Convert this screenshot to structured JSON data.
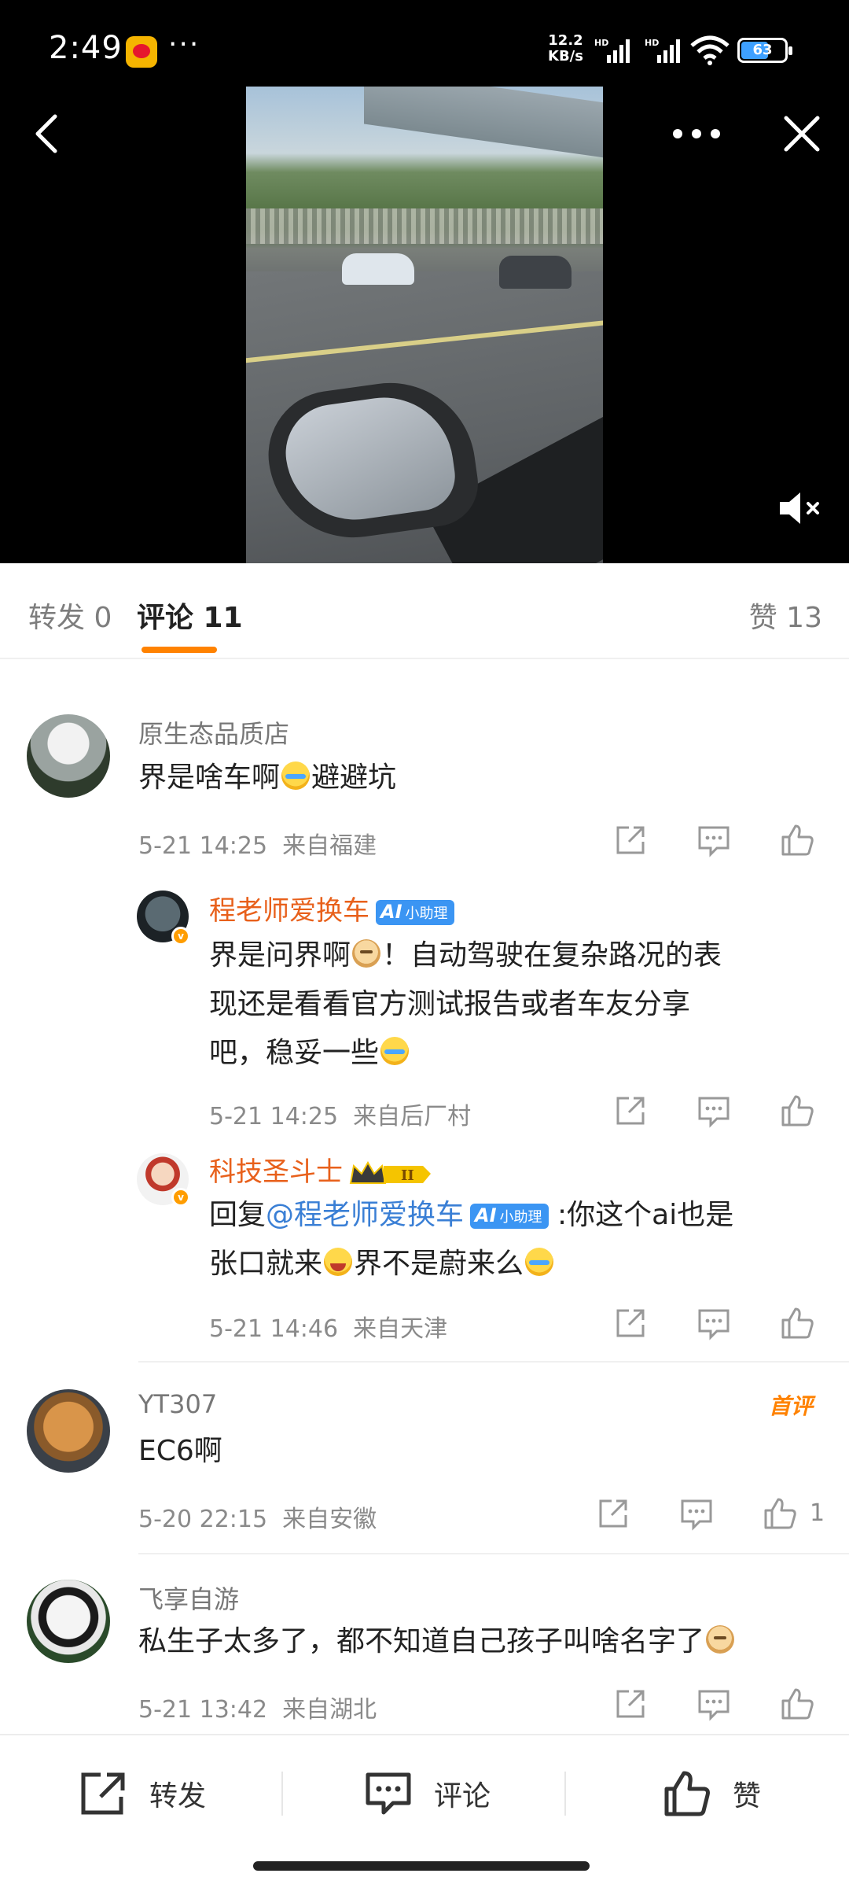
{
  "status_bar": {
    "time": "2:49",
    "more": "···",
    "net_speed_value": "12.2",
    "net_speed_unit": "KB/s",
    "battery": "63",
    "battery_fraction": 0.63
  },
  "video": {
    "back_icon": "chevron-left-icon",
    "more_icon": "more-horizontal-icon",
    "close_icon": "close-icon",
    "mute_icon": "speaker-muted-icon"
  },
  "tabs": {
    "repost": "转发 0",
    "comment": "评论 11",
    "like": "赞 13",
    "accent": "#ff8200"
  },
  "comments": [
    {
      "user": "原生态品质店",
      "text_parts": [
        "界是啥车啊",
        "避避坑"
      ],
      "time": "5-21 14:25",
      "location": "来自福建",
      "replies": [
        {
          "user": "程老师爱换车",
          "badge": "小助理",
          "text": "界是问界啊",
          "text2": "！自动驾驶在复杂路况的表",
          "text3": "现还是看看官方测试报告或者车友分享",
          "text4": "吧，稳妥一些",
          "time": "5-21 14:25",
          "location": "来自后厂村"
        },
        {
          "user": "科技圣斗士",
          "level_badge": "II",
          "reply_prefix": "回复",
          "mention": "@程老师爱换车",
          "badge": "小助理",
          "text1": ":你这个ai也是",
          "text2": "张口就来",
          "text3": "界不是蔚来么",
          "time": "5-21 14:46",
          "location": "来自天津"
        }
      ]
    },
    {
      "user": "YT307",
      "first_badge": "首评",
      "text": "EC6啊",
      "time": "5-20 22:15",
      "location": "来自安徽",
      "like_count": "1"
    },
    {
      "user": "飞享自游",
      "text": "私生子太多了，都不知道自己孩子叫啥名字了",
      "time": "5-21 13:42",
      "location": "来自湖北"
    }
  ],
  "bottom_bar": {
    "repost": "转发",
    "comment": "评论",
    "like": "赞"
  },
  "colors": {
    "orange_name": "#e8601b",
    "mention_blue": "#3a7fd5",
    "ai_badge": "#3b95f3"
  }
}
